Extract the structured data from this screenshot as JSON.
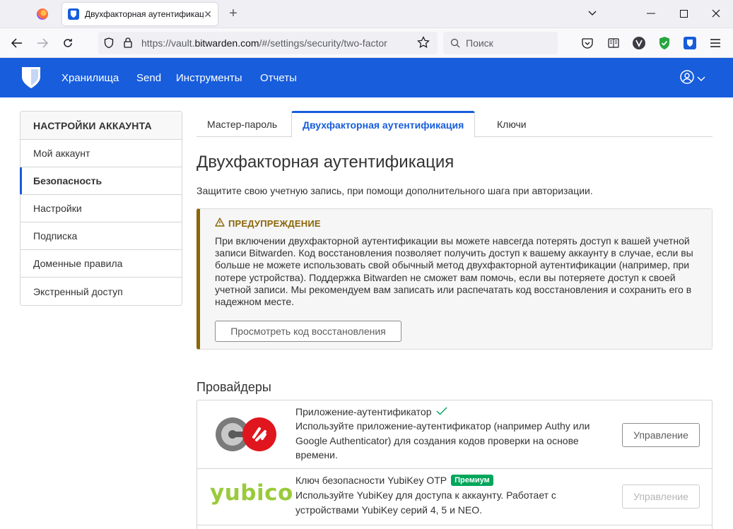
{
  "browser": {
    "tab_title": "Двухфакторная аутентификация",
    "url_prefix": "https://vault.",
    "url_domain": "bitwarden.com",
    "url_path": "/#/settings/security/two-factor",
    "search_placeholder": "Поиск"
  },
  "app": {
    "nav": [
      "Хранилища",
      "Send",
      "Инструменты",
      "Отчеты"
    ]
  },
  "sidebar": {
    "heading": "НАСТРОЙКИ АККАУНТА",
    "items": [
      "Мой аккаунт",
      "Безопасность",
      "Настройки",
      "Подписка",
      "Доменные правила",
      "Экстренный доступ"
    ],
    "active_index": 1
  },
  "tabs": [
    "Мастер-пароль",
    "Двухфакторная аутентификация",
    "Ключи"
  ],
  "page": {
    "title": "Двухфакторная аутентификация",
    "description": "Защитите свою учетную запись, при помощи дополнительного шага при авторизации."
  },
  "warning": {
    "title": "ПРЕДУПРЕЖДЕНИЕ",
    "body": "При включении двухфакторной аутентификации вы можете навсегда потерять доступ к вашей учетной записи Bitwarden. Код восстановления позволяет получить доступ к вашему аккаунту в случае, если вы больше не можете использовать свой обычный метод двухфакторной аутентификации (например, при потере устройства). Поддержка Bitwarden не сможет вам помочь, если вы потеряете доступ к своей учетной записи. Мы рекомендуем вам записать или распечатать код восстановления и сохранить его в надежном месте.",
    "button": "Просмотреть код восстановления"
  },
  "providers": {
    "heading": "Провайдеры",
    "items": [
      {
        "title": "Приложение-аутентификатор",
        "enabled": true,
        "description": "Используйте приложение-аутентификатор (например Authy или Google Authenticator) для создания кодов проверки на основе времени.",
        "button": "Управление"
      },
      {
        "title": "Ключ безопасности YubiKey OTP",
        "badge": "Премиум",
        "logo_text": "yubico",
        "description": "Используйте YubiKey для доступа к аккаунту. Работает с устройствами YubiKey серий 4, 5 и NEO.",
        "button": "Управление"
      }
    ]
  },
  "colors": {
    "brand": "#175ddc",
    "warning": "#8b6609",
    "premium": "#00a65a",
    "yubico": "#9aca3c"
  }
}
